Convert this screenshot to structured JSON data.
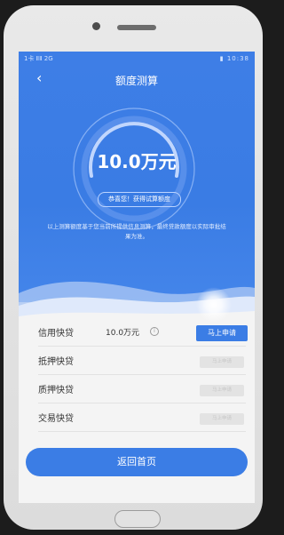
{
  "status": {
    "left": "1卡 ⅡⅡ 2G",
    "right": "▮ 10:38"
  },
  "header": {
    "back_icon": "‹",
    "title": "额度测算"
  },
  "result": {
    "amount": "10.0万元",
    "badge": "恭喜您！获得试算额度",
    "note": "以上测算额度基于您当前所提供信息测算，最终贷款额度以实际审批结果为准。"
  },
  "loans": [
    {
      "name": "信用快贷",
      "value": "10.0万元",
      "info_icon": "i",
      "action": "马上申请",
      "enabled": true
    },
    {
      "name": "抵押快贷",
      "value": "",
      "action": "马上申请",
      "enabled": false
    },
    {
      "name": "质押快贷",
      "value": "",
      "action": "马上申请",
      "enabled": false
    },
    {
      "name": "交易快贷",
      "value": "",
      "action": "马上申请",
      "enabled": false
    }
  ],
  "footer": {
    "home_button": "返回首页"
  },
  "colors": {
    "primary": "#3b7de5",
    "hero": "#3e7ee6",
    "disabled": "#e3e3e3"
  }
}
